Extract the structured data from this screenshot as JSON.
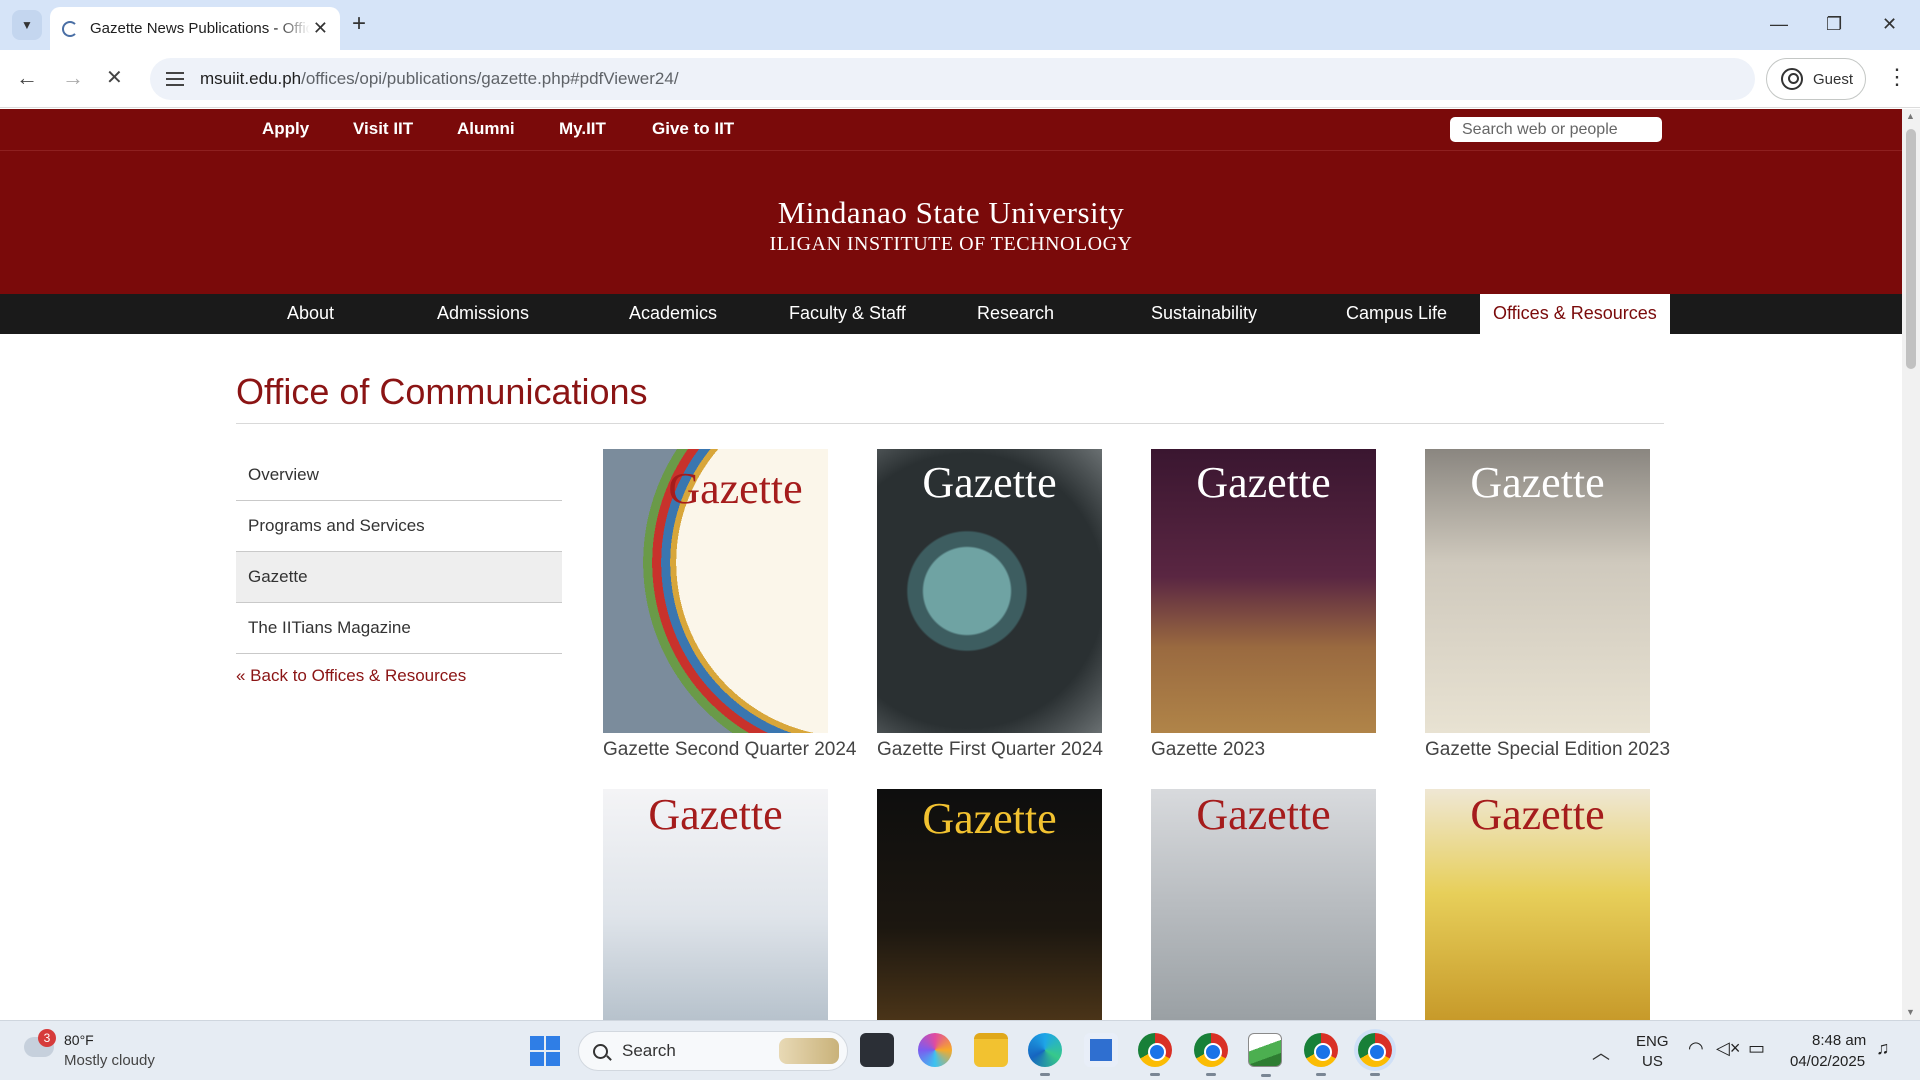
{
  "browser": {
    "tab_title": "Gazette News Publications - Offices of Public Information",
    "url_host": "msuiit.edu.ph",
    "url_path": "/offices/opi/publications/gazette.php#pdfViewer24/",
    "profile_label": "Guest"
  },
  "site": {
    "utility_links": [
      "Apply",
      "Visit IIT",
      "Alumni",
      "My.IIT",
      "Give to IIT"
    ],
    "search_placeholder": "Search web or people",
    "brand_line1": "Mindanao State University",
    "brand_line2": "ILIGAN INSTITUTE OF TECHNOLOGY",
    "nav": [
      "About",
      "Admissions",
      "Academics",
      "Faculty & Staff",
      "Research",
      "Sustainability",
      "Campus Life",
      "Offices & Resources"
    ],
    "nav_active": "Offices & Resources"
  },
  "page": {
    "title": "Office of Communications",
    "sidebar": [
      "Overview",
      "Programs and Services",
      "Gazette",
      "The IITians Magazine"
    ],
    "sidebar_active": "Gazette",
    "back_link": "« Back to Offices & Resources",
    "covers": [
      {
        "masthead": "Gazette",
        "caption": "Gazette Second Quarter 2024"
      },
      {
        "masthead": "Gazette",
        "caption": "Gazette First Quarter 2024"
      },
      {
        "masthead": "Gazette",
        "caption": "Gazette 2023"
      },
      {
        "masthead": "Gazette",
        "caption": "Gazette Special Edition 2023"
      },
      {
        "masthead": "Gazette",
        "caption": ""
      },
      {
        "masthead": "Gazette",
        "caption": ""
      },
      {
        "masthead": "Gazette",
        "caption": ""
      },
      {
        "masthead": "Gazette",
        "caption": ""
      }
    ]
  },
  "taskbar": {
    "weather_badge": "3",
    "weather_temp": "80°F",
    "weather_desc": "Mostly cloudy",
    "search_label": "Search",
    "lang_line1": "ENG",
    "lang_line2": "US",
    "time": "8:48 am",
    "date": "04/02/2025"
  },
  "colors": {
    "brand_maroon": "#7a0a0a",
    "title_red": "#8b1414",
    "nav_black": "#1a1a1a"
  }
}
